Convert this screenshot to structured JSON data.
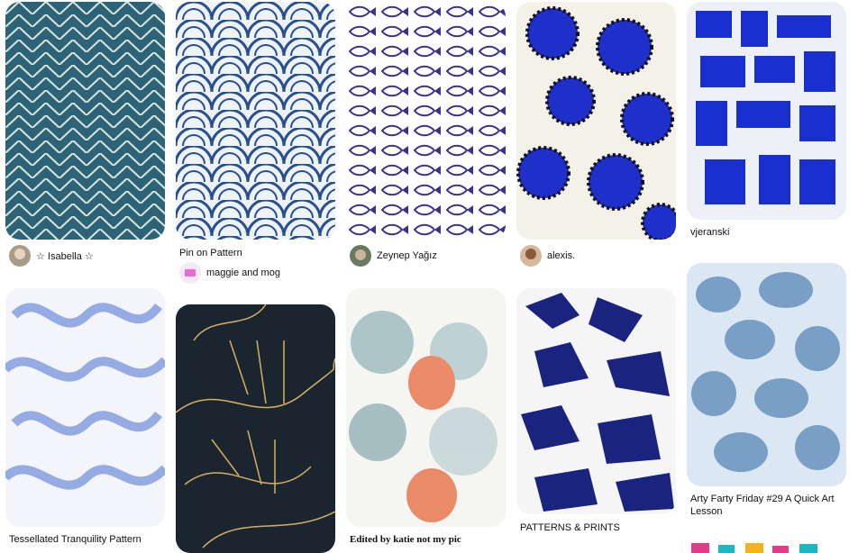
{
  "pins": [
    {
      "id": "herringbone",
      "title": "",
      "author": "☆ Isabella ☆"
    },
    {
      "id": "waves",
      "title": "Pin on Pattern",
      "author": "maggie and mog"
    },
    {
      "id": "fish",
      "title": "",
      "author": "Zeynep Yağız"
    },
    {
      "id": "dots",
      "title": "",
      "author": "alexis."
    },
    {
      "id": "blue-collage",
      "title": "vjeranski",
      "author": ""
    },
    {
      "id": "tessellated",
      "title": "Tessellated Tranquility Pattern",
      "author": ""
    },
    {
      "id": "gold-lines",
      "title": "",
      "author": ""
    },
    {
      "id": "coral",
      "title": "Edited by katie not my pic",
      "author": ""
    },
    {
      "id": "navy-abstract",
      "title": "PATTERNS & PRINTS",
      "author": ""
    },
    {
      "id": "watercolor",
      "title": "Arty Farty Friday #29 A Quick Art Lesson",
      "author": ""
    }
  ],
  "colors": {
    "brand_blue": "#1a2fd0",
    "teal": "#2a5a6a",
    "gold": "#d4b060",
    "coral": "#e8805a"
  }
}
